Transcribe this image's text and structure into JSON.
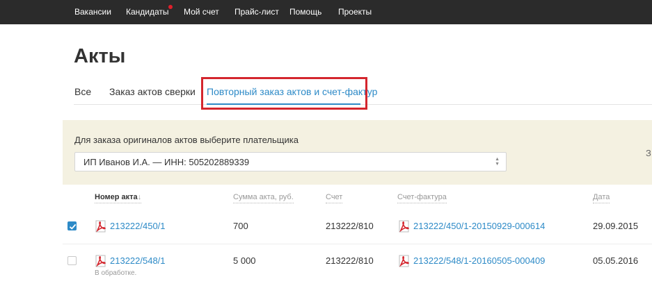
{
  "nav": {
    "items": [
      "Вакансии",
      "Кандидаты",
      "Мой счет",
      "Прайс-лист",
      "Помощь",
      "Проекты"
    ]
  },
  "page": {
    "title": "Акты"
  },
  "tabs": [
    {
      "label": "Все"
    },
    {
      "label": "Заказ актов сверки"
    },
    {
      "label": "Повторный заказ актов и счет-фактур"
    }
  ],
  "payer": {
    "label": "Для заказа оригиналов актов выберите плательщика",
    "selected": "ИП Иванов И.А. — ИНН: 505202889339",
    "edge_char": "З"
  },
  "table": {
    "columns": {
      "act_number": "Номер акта",
      "sort_icon": "↓",
      "amount": "Сумма акта, руб.",
      "invoice": "Счет",
      "invoice_factura": "Счет-фактура",
      "date": "Дата"
    },
    "rows": [
      {
        "checked": true,
        "act_number": "213222/450/1",
        "status": "",
        "amount": "700",
        "invoice": "213222/810",
        "invoice_factura": "213222/450/1-20150929-000614",
        "date": "29.09.2015"
      },
      {
        "checked": false,
        "act_number": "213222/548/1",
        "status": "В обработке.",
        "amount": "5 000",
        "invoice": "213222/810",
        "invoice_factura": "213222/548/1-20160505-000409",
        "date": "05.05.2016"
      }
    ]
  },
  "colors": {
    "nav_bg": "#2b2b2b",
    "accent": "#2d8ac7",
    "highlight": "#d4262e",
    "panel_bg": "#f4f1e1",
    "pdf_red": "#d4262e"
  }
}
